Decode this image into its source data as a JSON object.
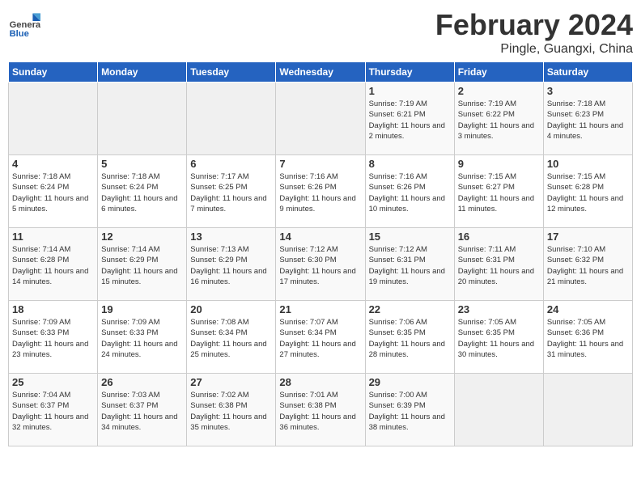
{
  "header": {
    "logo_text_general": "General",
    "logo_text_blue": "Blue",
    "month_title": "February 2024",
    "location": "Pingle, Guangxi, China"
  },
  "weekdays": [
    "Sunday",
    "Monday",
    "Tuesday",
    "Wednesday",
    "Thursday",
    "Friday",
    "Saturday"
  ],
  "weeks": [
    [
      {
        "day": "",
        "info": ""
      },
      {
        "day": "",
        "info": ""
      },
      {
        "day": "",
        "info": ""
      },
      {
        "day": "",
        "info": ""
      },
      {
        "day": "1",
        "info": "Sunrise: 7:19 AM\nSunset: 6:21 PM\nDaylight: 11 hours and 2 minutes."
      },
      {
        "day": "2",
        "info": "Sunrise: 7:19 AM\nSunset: 6:22 PM\nDaylight: 11 hours and 3 minutes."
      },
      {
        "day": "3",
        "info": "Sunrise: 7:18 AM\nSunset: 6:23 PM\nDaylight: 11 hours and 4 minutes."
      }
    ],
    [
      {
        "day": "4",
        "info": "Sunrise: 7:18 AM\nSunset: 6:24 PM\nDaylight: 11 hours and 5 minutes."
      },
      {
        "day": "5",
        "info": "Sunrise: 7:18 AM\nSunset: 6:24 PM\nDaylight: 11 hours and 6 minutes."
      },
      {
        "day": "6",
        "info": "Sunrise: 7:17 AM\nSunset: 6:25 PM\nDaylight: 11 hours and 7 minutes."
      },
      {
        "day": "7",
        "info": "Sunrise: 7:16 AM\nSunset: 6:26 PM\nDaylight: 11 hours and 9 minutes."
      },
      {
        "day": "8",
        "info": "Sunrise: 7:16 AM\nSunset: 6:26 PM\nDaylight: 11 hours and 10 minutes."
      },
      {
        "day": "9",
        "info": "Sunrise: 7:15 AM\nSunset: 6:27 PM\nDaylight: 11 hours and 11 minutes."
      },
      {
        "day": "10",
        "info": "Sunrise: 7:15 AM\nSunset: 6:28 PM\nDaylight: 11 hours and 12 minutes."
      }
    ],
    [
      {
        "day": "11",
        "info": "Sunrise: 7:14 AM\nSunset: 6:28 PM\nDaylight: 11 hours and 14 minutes."
      },
      {
        "day": "12",
        "info": "Sunrise: 7:14 AM\nSunset: 6:29 PM\nDaylight: 11 hours and 15 minutes."
      },
      {
        "day": "13",
        "info": "Sunrise: 7:13 AM\nSunset: 6:29 PM\nDaylight: 11 hours and 16 minutes."
      },
      {
        "day": "14",
        "info": "Sunrise: 7:12 AM\nSunset: 6:30 PM\nDaylight: 11 hours and 17 minutes."
      },
      {
        "day": "15",
        "info": "Sunrise: 7:12 AM\nSunset: 6:31 PM\nDaylight: 11 hours and 19 minutes."
      },
      {
        "day": "16",
        "info": "Sunrise: 7:11 AM\nSunset: 6:31 PM\nDaylight: 11 hours and 20 minutes."
      },
      {
        "day": "17",
        "info": "Sunrise: 7:10 AM\nSunset: 6:32 PM\nDaylight: 11 hours and 21 minutes."
      }
    ],
    [
      {
        "day": "18",
        "info": "Sunrise: 7:09 AM\nSunset: 6:33 PM\nDaylight: 11 hours and 23 minutes."
      },
      {
        "day": "19",
        "info": "Sunrise: 7:09 AM\nSunset: 6:33 PM\nDaylight: 11 hours and 24 minutes."
      },
      {
        "day": "20",
        "info": "Sunrise: 7:08 AM\nSunset: 6:34 PM\nDaylight: 11 hours and 25 minutes."
      },
      {
        "day": "21",
        "info": "Sunrise: 7:07 AM\nSunset: 6:34 PM\nDaylight: 11 hours and 27 minutes."
      },
      {
        "day": "22",
        "info": "Sunrise: 7:06 AM\nSunset: 6:35 PM\nDaylight: 11 hours and 28 minutes."
      },
      {
        "day": "23",
        "info": "Sunrise: 7:05 AM\nSunset: 6:35 PM\nDaylight: 11 hours and 30 minutes."
      },
      {
        "day": "24",
        "info": "Sunrise: 7:05 AM\nSunset: 6:36 PM\nDaylight: 11 hours and 31 minutes."
      }
    ],
    [
      {
        "day": "25",
        "info": "Sunrise: 7:04 AM\nSunset: 6:37 PM\nDaylight: 11 hours and 32 minutes."
      },
      {
        "day": "26",
        "info": "Sunrise: 7:03 AM\nSunset: 6:37 PM\nDaylight: 11 hours and 34 minutes."
      },
      {
        "day": "27",
        "info": "Sunrise: 7:02 AM\nSunset: 6:38 PM\nDaylight: 11 hours and 35 minutes."
      },
      {
        "day": "28",
        "info": "Sunrise: 7:01 AM\nSunset: 6:38 PM\nDaylight: 11 hours and 36 minutes."
      },
      {
        "day": "29",
        "info": "Sunrise: 7:00 AM\nSunset: 6:39 PM\nDaylight: 11 hours and 38 minutes."
      },
      {
        "day": "",
        "info": ""
      },
      {
        "day": "",
        "info": ""
      }
    ]
  ]
}
